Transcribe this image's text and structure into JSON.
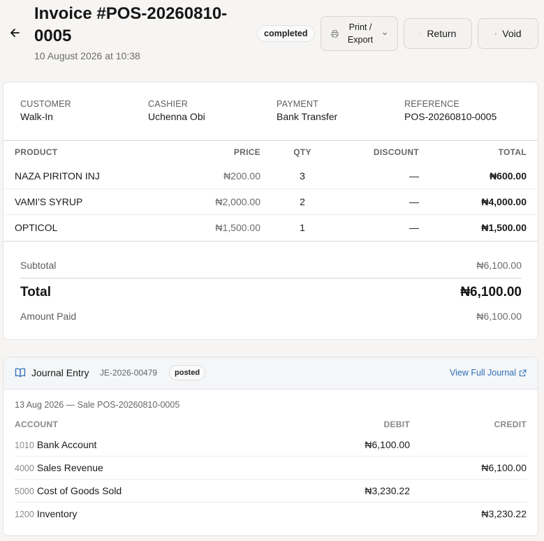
{
  "header": {
    "title": "Invoice #POS-20260810-0005",
    "subtitle": "10 August 2026 at 10:38",
    "status": "completed",
    "print_label": "Print / Export",
    "return_label": "Return",
    "void_label": "Void"
  },
  "meta": [
    {
      "label": "CUSTOMER",
      "value": "Walk-In"
    },
    {
      "label": "CASHIER",
      "value": "Uchenna Obi"
    },
    {
      "label": "PAYMENT",
      "value": "Bank Transfer"
    },
    {
      "label": "REFERENCE",
      "value": "POS-20260810-0005"
    }
  ],
  "items": {
    "columns": {
      "product": "PRODUCT",
      "price": "PRICE",
      "qty": "QTY",
      "discount": "DISCOUNT",
      "total": "TOTAL"
    },
    "rows": [
      {
        "product": "NAZA PIRITON INJ",
        "price": "₦200.00",
        "qty": "3",
        "discount": "—",
        "total": "₦600.00"
      },
      {
        "product": "VAMI'S SYRUP",
        "price": "₦2,000.00",
        "qty": "2",
        "discount": "—",
        "total": "₦4,000.00"
      },
      {
        "product": "OPTICOL",
        "price": "₦1,500.00",
        "qty": "1",
        "discount": "—",
        "total": "₦1,500.00"
      }
    ]
  },
  "summary": {
    "subtotal_label": "Subtotal",
    "subtotal_value": "₦6,100.00",
    "total_label": "Total",
    "total_value": "₦6,100.00",
    "paid_label": "Amount Paid",
    "paid_value": "₦6,100.00"
  },
  "journal": {
    "title": "Journal Entry",
    "id": "JE-2026-00479",
    "status": "posted",
    "link_label": "View Full Journal",
    "description": "13 Aug 2026 — Sale POS-20260810-0005",
    "columns": {
      "account": "ACCOUNT",
      "debit": "DEBIT",
      "credit": "CREDIT"
    },
    "rows": [
      {
        "code": "1010",
        "account": "Bank Account",
        "debit": "₦6,100.00",
        "credit": ""
      },
      {
        "code": "4000",
        "account": "Sales Revenue",
        "debit": "",
        "credit": "₦6,100.00"
      },
      {
        "code": "5000",
        "account": "Cost of Goods Sold",
        "debit": "₦3,230.22",
        "credit": ""
      },
      {
        "code": "1200",
        "account": "Inventory",
        "debit": "",
        "credit": "₦3,230.22"
      }
    ]
  },
  "colors": {
    "accent_link": "#2f6eb8",
    "background": "#f6f5f3"
  },
  "icons": {
    "back": "arrow-left-icon",
    "print": "printer-icon",
    "journal": "book-open-icon",
    "external": "external-link-icon"
  }
}
